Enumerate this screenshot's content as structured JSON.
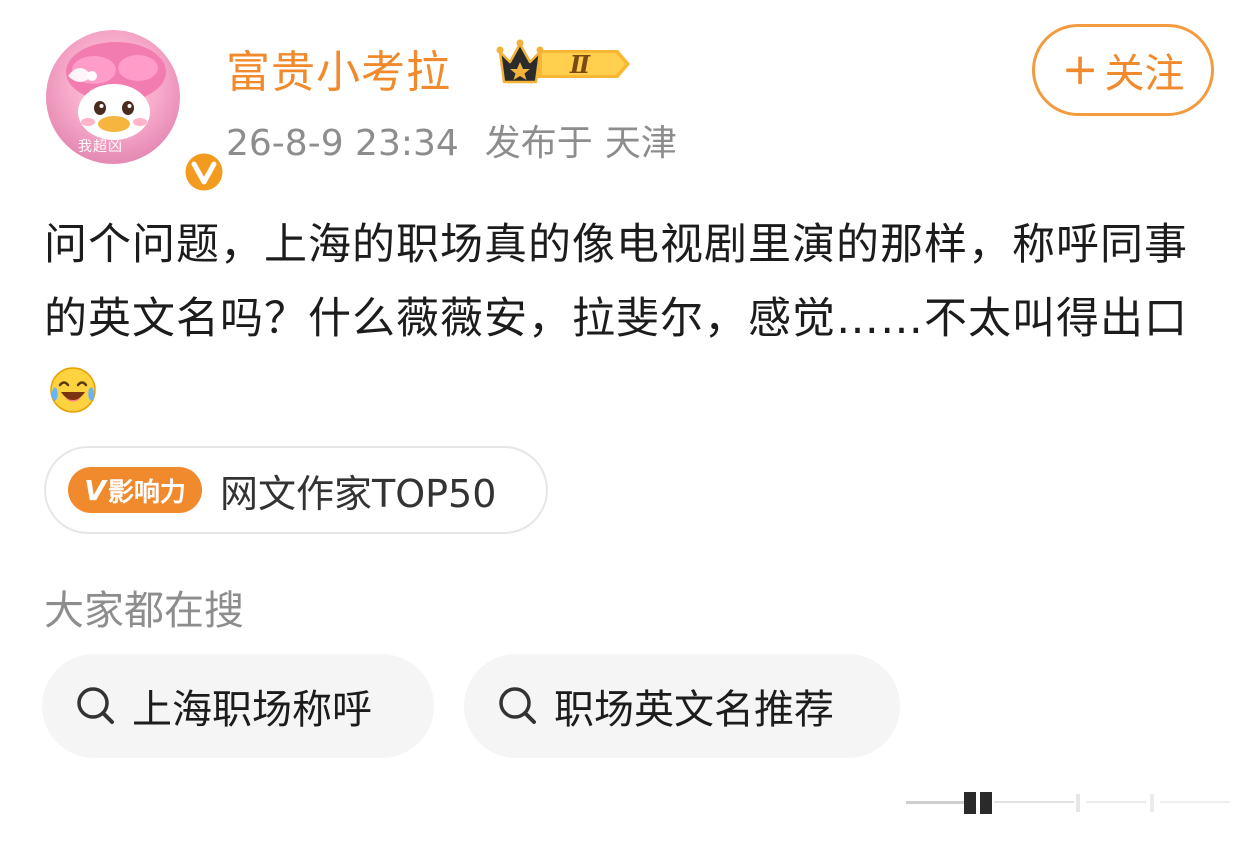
{
  "author": {
    "name": "富贵小考拉",
    "avatar_caption": "我超凶",
    "level_badge": "Ⅱ",
    "verified": true,
    "colors": {
      "name": "#f08a2c",
      "verified_badge": "#f29b1e"
    }
  },
  "meta": {
    "timestamp": "26-8-9 23:34",
    "published_label": "发布于",
    "location": "天津"
  },
  "follow_button": {
    "icon": "plus-icon",
    "plus": "+",
    "label": "关注",
    "color": "#f08a2c"
  },
  "post": {
    "text": "问个问题，上海的职场真的像电视剧里演的那样，称呼同事的英文名吗？什么薇薇安，拉斐尔，感觉……不太叫得出口",
    "emoji": "laughing-crying-emoji"
  },
  "influence_badge": {
    "pill_v": "V",
    "pill_label": "影响力",
    "text": "网文作家TOP50",
    "color": "#f08a2c"
  },
  "search_section": {
    "heading": "大家都在搜",
    "chips": [
      {
        "icon": "search-icon",
        "label": "上海职场称呼"
      },
      {
        "icon": "search-icon",
        "label": "职场英文名推荐"
      }
    ]
  }
}
